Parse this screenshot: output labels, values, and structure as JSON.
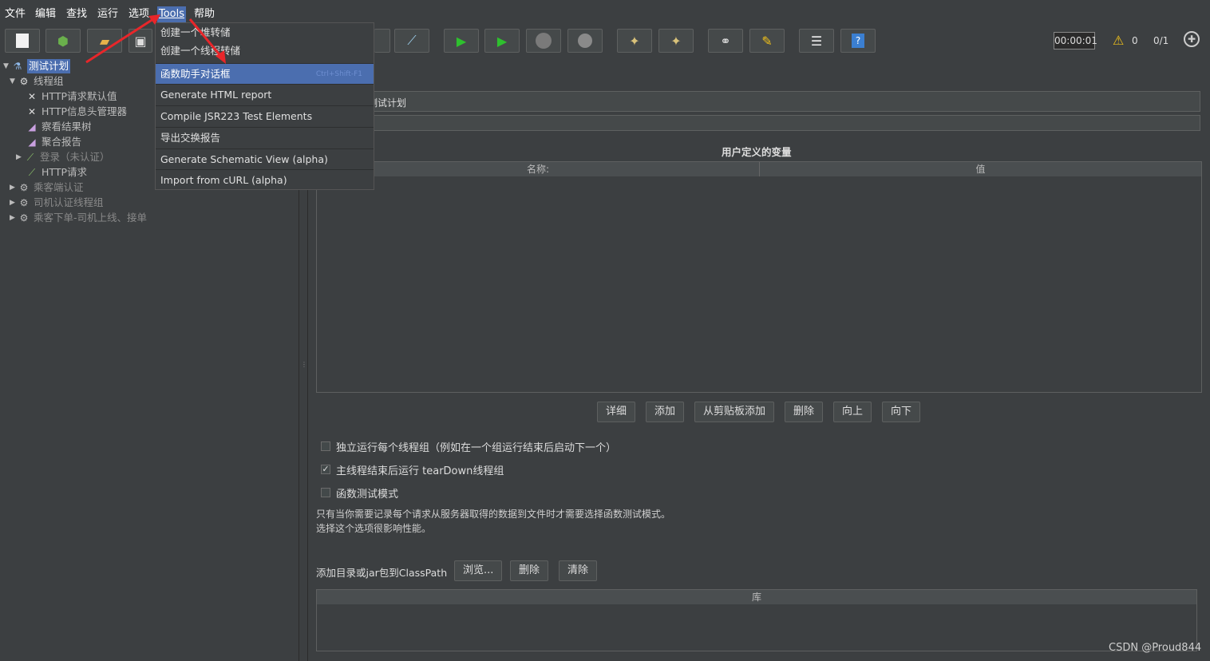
{
  "menubar": {
    "items": [
      "文件",
      "编辑",
      "查找",
      "运行",
      "选项",
      "Tools",
      "帮助"
    ]
  },
  "toolbar": {
    "timer": "00:00:01",
    "warning_count": "0",
    "thread_ratio": "0/1"
  },
  "tools_menu": {
    "items": [
      {
        "label": "创建一个堆转储"
      },
      {
        "label": "创建一个线程转储"
      },
      {
        "label": "函数助手对话框",
        "shortcut": "Ctrl+Shift-F1"
      },
      {
        "label": "Generate HTML report"
      },
      {
        "label": "Compile JSR223 Test Elements"
      },
      {
        "label": "导出交换报告"
      },
      {
        "label": "Generate Schematic View (alpha)"
      },
      {
        "label": "Import from cURL (alpha)"
      }
    ]
  },
  "tree": {
    "nodes": [
      {
        "label": "测试计划"
      },
      {
        "label": "线程组"
      },
      {
        "label": "HTTP请求默认值"
      },
      {
        "label": "HTTP信息头管理器"
      },
      {
        "label": "察看结果树"
      },
      {
        "label": "聚合报告"
      },
      {
        "label": "登录（未认证）"
      },
      {
        "label": "HTTP请求"
      },
      {
        "label": "乘客端认证"
      },
      {
        "label": "司机认证线程组"
      },
      {
        "label": "乘客下单-司机上线、接单"
      }
    ]
  },
  "main": {
    "name_value": "测试计划",
    "user_vars_title": "用户定义的变量",
    "col_name": "名称:",
    "col_value": "值",
    "buttons": [
      "详细",
      "添加",
      "从剪贴板添加",
      "删除",
      "向上",
      "向下"
    ],
    "checkbox1": "独立运行每个线程组（例如在一个组运行结束后启动下一个）",
    "checkbox2": "主线程结束后运行 tearDown线程组",
    "checkbox3": "函数测试模式",
    "note_line1": "只有当你需要记录每个请求从服务器取得的数据到文件时才需要选择函数测试模式。",
    "note_line2": "选择这个选项很影响性能。",
    "classpath_label": "添加目录或jar包到ClassPath",
    "classpath_buttons": [
      "浏览...",
      "删除",
      "清除"
    ],
    "lib_header": "库"
  },
  "watermark": "CSDN @Proud844",
  "colors": {
    "accent": "#4b6eaf",
    "background": "#3c3f41",
    "arrow": "#e8262a"
  }
}
